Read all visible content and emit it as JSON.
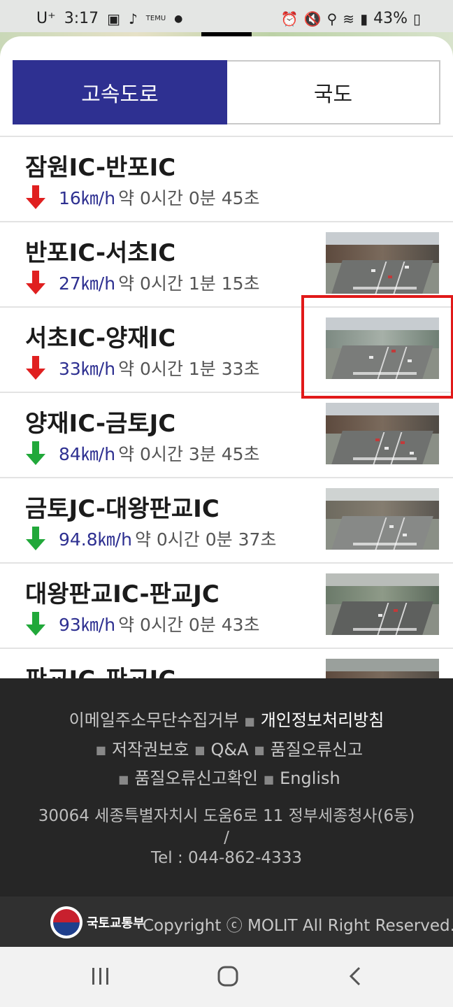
{
  "status_bar": {
    "carrier": "U⁺",
    "time": "3:17",
    "battery": "43%",
    "left_icons": [
      "gallery-icon",
      "tiktok-icon",
      "temu-icon",
      "dot-icon"
    ],
    "right_icons": [
      "alarm-icon",
      "mute-icon",
      "location-icon",
      "wifi-icon",
      "signal-icon",
      "battery-icon"
    ]
  },
  "tabs": [
    {
      "label": "고속도로",
      "active": true
    },
    {
      "label": "국도",
      "active": false
    }
  ],
  "routes": [
    {
      "name": "잠원IC-반포IC",
      "speed": "16㎞/h",
      "eta": "약 0시간 0분 45초",
      "trend": "down",
      "has_thumb": false
    },
    {
      "name": "반포IC-서초IC",
      "speed": "27㎞/h",
      "eta": "약 0시간 1분 15초",
      "trend": "down",
      "has_thumb": true
    },
    {
      "name": "서초IC-양재IC",
      "speed": "33㎞/h",
      "eta": "약 0시간 1분 33초",
      "trend": "down",
      "has_thumb": true
    },
    {
      "name": "양재IC-금토JC",
      "speed": "84㎞/h",
      "eta": "약 0시간 3분 45초",
      "trend": "up",
      "has_thumb": true
    },
    {
      "name": "금토JC-대왕판교IC",
      "speed": "94.8㎞/h",
      "eta": "약 0시간 0분 37초",
      "trend": "up",
      "has_thumb": true
    },
    {
      "name": "대왕판교IC-판교JC",
      "speed": "93㎞/h",
      "eta": "약 0시간 0분 43초",
      "trend": "up",
      "has_thumb": true
    },
    {
      "name": "판교JC-판교IC",
      "speed": "",
      "eta": "",
      "trend": "",
      "has_thumb": true
    }
  ],
  "colors": {
    "accent": "#2e3091",
    "arrow_down": "#e02020",
    "arrow_up": "#21a83a",
    "highlight": "#e11919",
    "footer_bg": "#262626"
  },
  "footer": {
    "links": [
      "이메일주소무단수집거부",
      "개인정보처리방침",
      "저작권보호",
      "Q&A",
      "품질오류신고",
      "품질오류신고확인",
      "English"
    ],
    "address": "30064 세종특별자치시 도움6로 11 정부세종청사(6동)",
    "separator": "/",
    "tel": "Tel : 044-862-4333",
    "org_name": "국토교통부",
    "copyright": "Copyright ⓒ MOLIT All Right Reserved."
  },
  "navbar": {
    "icons": [
      "recent-apps-icon",
      "home-icon",
      "back-icon"
    ]
  }
}
